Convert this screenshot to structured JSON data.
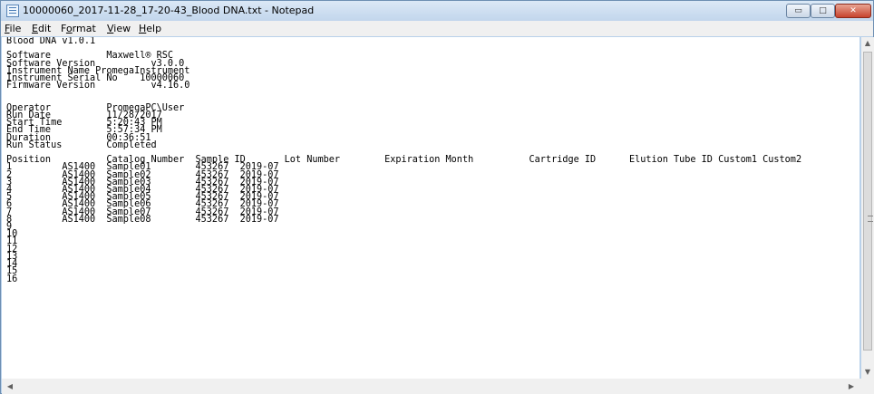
{
  "window": {
    "title": "10000060_2017-11-28_17-20-43_Blood DNA.txt - Notepad",
    "controls": {
      "minimize": "▭",
      "maximize": "□",
      "close": "✕"
    }
  },
  "menu": [
    {
      "label": "File",
      "mnemonic": "F",
      "rest": "ile"
    },
    {
      "label": "Edit",
      "mnemonic": "E",
      "rest": "dit"
    },
    {
      "label": "Format",
      "pre": "F",
      "mnemonic": "o",
      "rest": "rmat"
    },
    {
      "label": "View",
      "mnemonic": "V",
      "rest": "iew"
    },
    {
      "label": "Help",
      "mnemonic": "H",
      "rest": "elp"
    }
  ],
  "document": {
    "text": "Blood DNA v1.0.1\n\nSoftware          Maxwell® RSC\nSoftware Version          v3.0.0\nInstrument Name PromegaInstrument\nInstrument Serial No    10000060\nFirmware Version          v4.16.0\n\n\nOperator          PromegaPC\\User\nRun Date          11/28/2017\nStart Time        5:20:43 PM\nEnd Time          5:57:34 PM\nDuration          00:36:51\nRun Status        Completed\n\nPosition          Catalog Number  Sample ID       Lot Number        Expiration Month          Cartridge ID      Elution Tube ID Custom1 Custom2\n1         AS1400  Sample01        453267  2019-07\n2         AS1400  Sample02        453267  2019-07\n3         AS1400  Sample03        453267  2019-07\n4         AS1400  Sample04        453267  2019-07\n5         AS1400  Sample05        453267  2019-07\n6         AS1400  Sample06        453267  2019-07\n7         AS1400  Sample07        453267  2019-07\n8         AS1400  Sample08        453267  2019-07\n9\n10\n11\n12\n13\n14\n15\n16"
  },
  "scrollbars": {
    "up_arrow": "▲",
    "down_arrow": "▼",
    "left_arrow": "◀",
    "right_arrow": "▶"
  }
}
